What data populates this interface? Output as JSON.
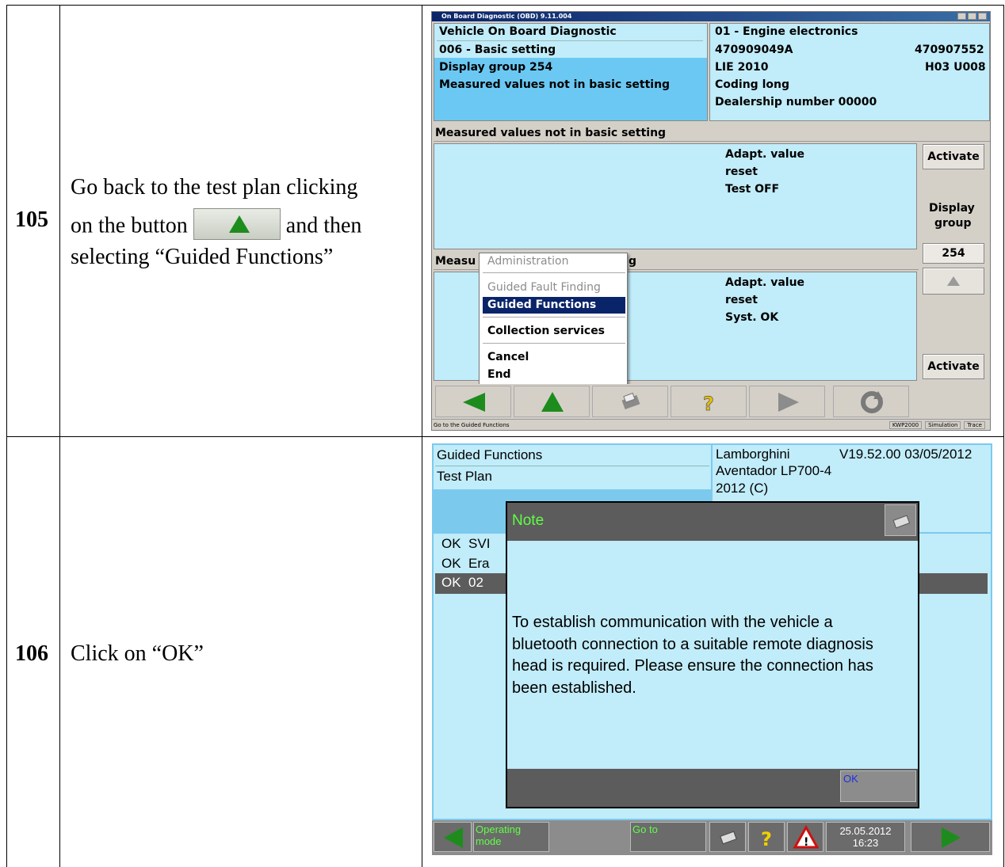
{
  "rows": [
    {
      "number": "105",
      "instruction_part1": "Go back to the test plan clicking",
      "instruction_part2a": "on the button",
      "instruction_part2b": "and then",
      "instruction_part3": "selecting “Guided Functions”"
    },
    {
      "number": "106",
      "instruction": "Click on “OK”"
    }
  ],
  "screen1": {
    "window_title": "On Board Diagnostic (OBD) 9.11.004",
    "header_left": [
      "Vehicle On Board Diagnostic",
      "006 - Basic setting",
      "Display group 254",
      "Measured values not in basic setting"
    ],
    "header_right": {
      "module": "01 - Engine electronics",
      "part_no": "470909049A",
      "part_no_right": "470907552",
      "lie": "LIE 2010",
      "hw": "H03  U008",
      "coding": "Coding long",
      "dealer": "Dealership number 00000"
    },
    "section1_title": "Measured values not in basic setting",
    "section1_values": [
      "Adapt. value",
      "reset",
      "Test OFF"
    ],
    "section2_title_left": "Measu",
    "section2_title_right": "g",
    "section2_values": [
      "Adapt. value",
      "reset",
      "Syst. OK"
    ],
    "side_buttons": {
      "activate_top": "Activate",
      "display_group_label_1": "Display",
      "display_group_label_2": "group",
      "display_group_value": "254",
      "activate_bottom": "Activate"
    },
    "menu": {
      "items": [
        "Administration",
        "Guided Fault Finding",
        "Guided Functions",
        "Collection services",
        "Cancel",
        "End"
      ],
      "selected": "Guided Functions"
    },
    "status_text": "Go to the Guided Functions",
    "status_right": [
      "KWP2000",
      "Simulation",
      "Trace"
    ]
  },
  "screen2": {
    "header_left": [
      "Guided Functions",
      "Test Plan"
    ],
    "brand": "Lamborghini",
    "version": "V19.52.00 03/05/2012",
    "model": "Aventador LP700-4",
    "year": "2012 (C)",
    "list": [
      {
        "status": "OK",
        "text": "SVI"
      },
      {
        "status": "OK",
        "text": "Era"
      },
      {
        "status": "OK",
        "text": "02"
      }
    ],
    "dialog": {
      "title": "Note",
      "message": "To establish communication with the vehicle a bluetooth connection to a suitable remote diagnosis head is required. Please ensure the connection has been established.",
      "ok_label": "OK"
    },
    "bottom": {
      "operating_mode": "Operating mode",
      "go_to": "Go to",
      "date": "25.05.2012",
      "time": "16:23"
    }
  },
  "colors": {
    "screen_cyan": "#c1ecf9",
    "screen_blue": "#6bc8f3",
    "menu_selected": "#0a246a",
    "note_title": "#5fff46",
    "arrow_green": "#1d8c1d"
  }
}
